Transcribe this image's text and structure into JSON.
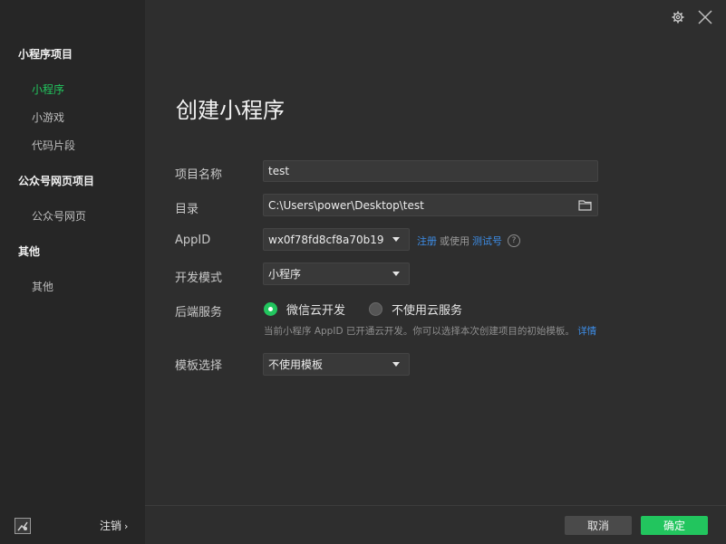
{
  "sidebar": {
    "groups": [
      {
        "title": "小程序项目",
        "items": [
          "小程序",
          "小游戏",
          "代码片段"
        ]
      },
      {
        "title": "公众号网页项目",
        "items": [
          "公众号网页"
        ]
      },
      {
        "title": "其他",
        "items": [
          "其他"
        ]
      }
    ],
    "active_item": "小程序",
    "logout_label": "注销",
    "logout_chevron": "›"
  },
  "main": {
    "title": "创建小程序",
    "form": {
      "project_name_label": "项目名称",
      "project_name_value": "test",
      "directory_label": "目录",
      "directory_value": "C:\\Users\\power\\Desktop\\test",
      "appid_label": "AppID",
      "appid_value": "wx0f78fd8cf8a70b19",
      "register_link": "注册",
      "or_use_text": "或使用",
      "test_account_link": "测试号",
      "help_icon_text": "?",
      "dev_mode_label": "开发模式",
      "dev_mode_value": "小程序",
      "backend_label": "后端服务",
      "backend_option_cloud": "微信云开发",
      "backend_option_none": "不使用云服务",
      "backend_selected": "微信云开发",
      "backend_hint": "当前小程序 AppID 已开通云开发。你可以选择本次创建项目的初始模板。",
      "details_link": "详情",
      "template_label": "模板选择",
      "template_value": "不使用模板"
    },
    "buttons": {
      "cancel": "取消",
      "confirm": "确定"
    }
  },
  "colors": {
    "accent_green": "#22c55e",
    "link_blue": "#3d8ee8",
    "sidebar_bg": "#262626",
    "main_bg": "#2e2e2e"
  },
  "icons": {
    "top_right": [
      "gear-icon",
      "close-icon"
    ],
    "directory": "folder-icon",
    "avatar": "user-avatar-icon"
  }
}
